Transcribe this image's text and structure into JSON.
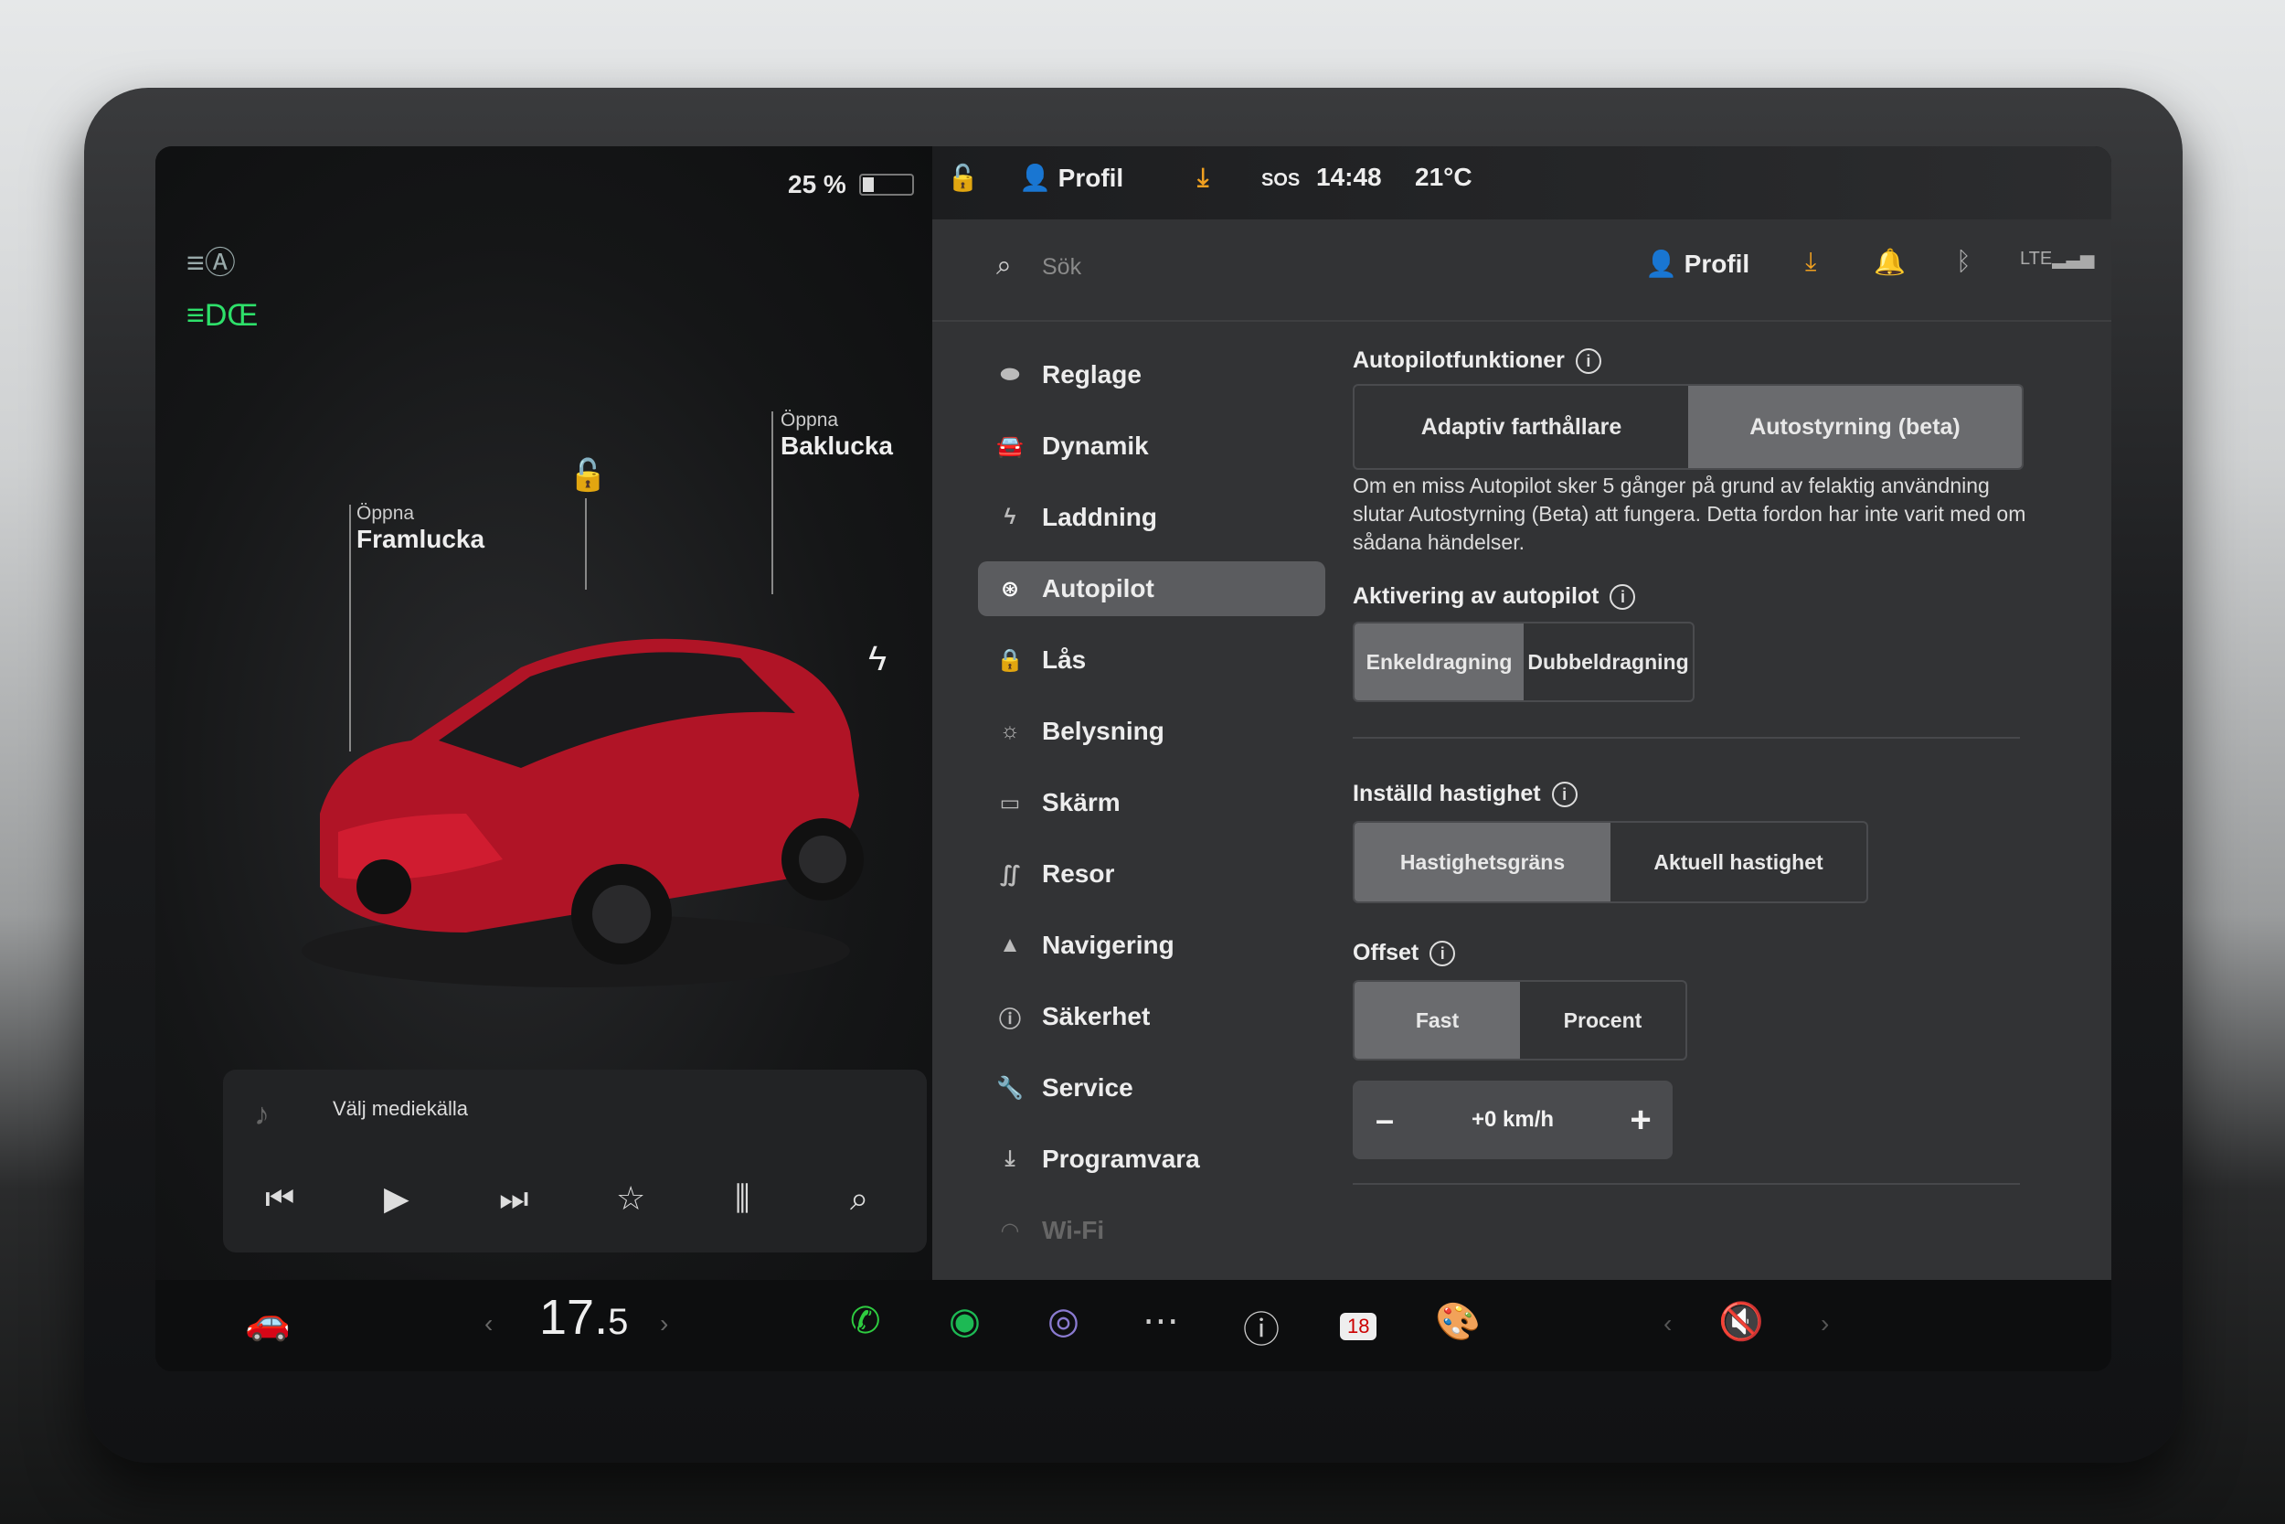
{
  "status": {
    "battery": "25 %",
    "profile": "Profil",
    "sos": "SOS",
    "time": "14:48",
    "outside_temp": "21°C"
  },
  "car": {
    "front_small": "Öppna",
    "front_big": "Framlucka",
    "trunk_small": "Öppna",
    "trunk_big": "Baklucka"
  },
  "media": {
    "source": "Välj mediekälla"
  },
  "header": {
    "search_placeholder": "Sök",
    "profile": "Profil"
  },
  "nav": {
    "items": [
      {
        "label": "Reglage",
        "icon": "toggle-icon"
      },
      {
        "label": "Dynamik",
        "icon": "car-icon"
      },
      {
        "label": "Laddning",
        "icon": "bolt-icon"
      },
      {
        "label": "Autopilot",
        "icon": "steering-wheel-icon"
      },
      {
        "label": "Lås",
        "icon": "lock-icon"
      },
      {
        "label": "Belysning",
        "icon": "sun-icon"
      },
      {
        "label": "Skärm",
        "icon": "display-icon"
      },
      {
        "label": "Resor",
        "icon": "trips-icon"
      },
      {
        "label": "Navigering",
        "icon": "navigation-icon"
      },
      {
        "label": "Säkerhet",
        "icon": "safety-icon"
      },
      {
        "label": "Service",
        "icon": "wrench-icon"
      },
      {
        "label": "Programvara",
        "icon": "download-icon"
      },
      {
        "label": "Wi-Fi",
        "icon": "wifi-icon"
      }
    ],
    "active": "Autopilot"
  },
  "autopilot": {
    "features_title": "Autopilotfunktioner",
    "features_options": [
      "Adaptiv farthållare",
      "Autostyrning (beta)"
    ],
    "features_selected": "Autostyrning (beta)",
    "note": "Om en miss Autopilot sker 5 gånger på grund av felaktig användning slutar Autostyrning (Beta) att fungera. Detta fordon har inte varit med om sådana händelser.",
    "activation_title": "Aktivering av autopilot",
    "activation_options": [
      "Enkeldragning",
      "Dubbeldragning"
    ],
    "activation_selected": "Enkeldragning",
    "speed_title": "Inställd hastighet",
    "speed_options": [
      "Hastighetsgräns",
      "Aktuell hastighet"
    ],
    "speed_selected": "Hastighetsgräns",
    "offset_title": "Offset",
    "offset_options": [
      "Fast",
      "Procent"
    ],
    "offset_selected": "Fast",
    "offset_value": "+0 km/h",
    "minus": "–",
    "plus": "+"
  },
  "dock": {
    "temp_main": "17.",
    "temp_decimal": "5",
    "calendar_day": "18",
    "colors": {
      "phone": "#2ecc40",
      "spotify": "#1db954"
    }
  }
}
